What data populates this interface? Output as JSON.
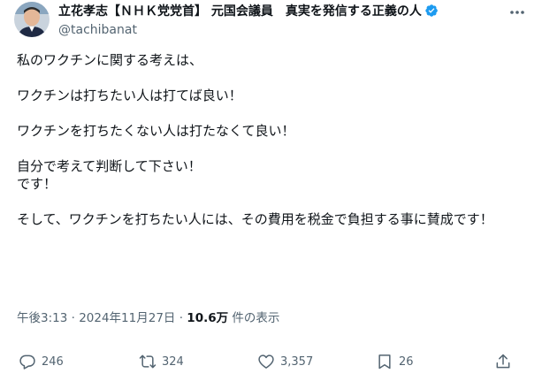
{
  "author": {
    "display_name": "立花孝志【ＮＨＫ党党首】 元国会議員　真実を発信する正義の人",
    "handle": "@tachibanat"
  },
  "tweet": {
    "text": "私のワクチンに関する考えは、\n\nワクチンは打ちたい人は打てば良い！\n\nワクチンを打ちたくない人は打たなくて良い！\n\n自分で考えて判断して下さい！\nです！\n\nそして、ワクチンを打ちたい人には、その費用を税金で負担する事に賛成です！",
    "time": "午後3:13",
    "separator": " · ",
    "date": "2024年11月27日",
    "views_count": "10.6万",
    "views_label": " 件の表示"
  },
  "actions": {
    "reply_count": "246",
    "retweet_count": "324",
    "like_count": "3,357",
    "bookmark_count": "26"
  },
  "colors": {
    "text_primary": "#0f1419",
    "text_secondary": "#536471",
    "verified_blue": "#1d9bf0"
  },
  "icons": {
    "verified": "verified-badge-icon",
    "more": "more-dots-icon",
    "reply": "reply-icon",
    "retweet": "retweet-icon",
    "like": "heart-icon",
    "bookmark": "bookmark-icon",
    "share": "share-icon"
  }
}
